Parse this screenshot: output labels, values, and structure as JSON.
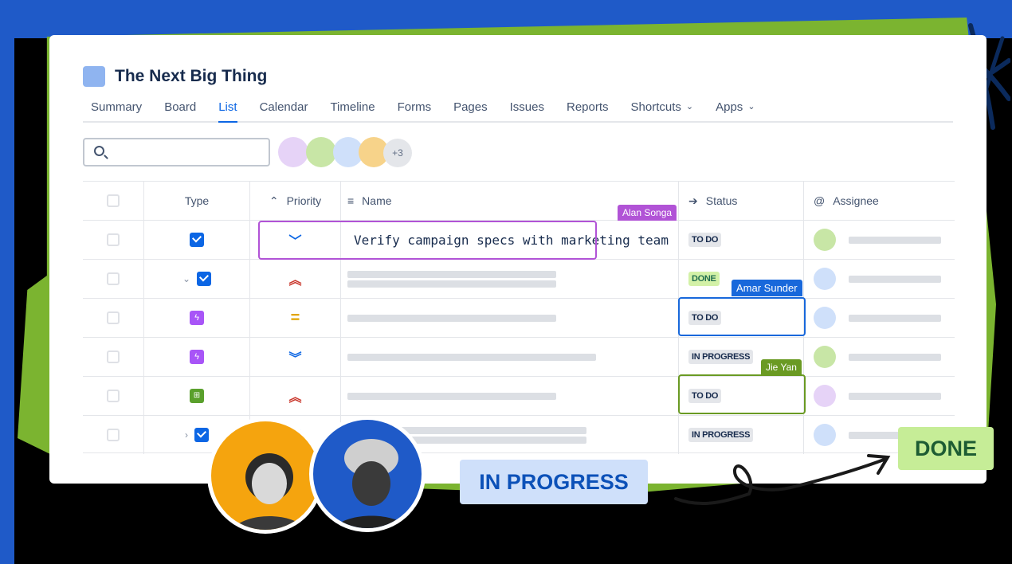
{
  "project": {
    "title": "The Next Big Thing",
    "icon_color": "#8fb4f0"
  },
  "tabs": [
    {
      "label": "Summary",
      "active": false
    },
    {
      "label": "Board",
      "active": false
    },
    {
      "label": "List",
      "active": true
    },
    {
      "label": "Calendar",
      "active": false
    },
    {
      "label": "Timeline",
      "active": false
    },
    {
      "label": "Forms",
      "active": false
    },
    {
      "label": "Pages",
      "active": false
    },
    {
      "label": "Issues",
      "active": false
    },
    {
      "label": "Reports",
      "active": false
    },
    {
      "label": "Shortcuts",
      "active": false,
      "dropdown": true
    },
    {
      "label": "Apps",
      "active": false,
      "dropdown": true
    }
  ],
  "search": {
    "placeholder": "",
    "icon": "search-icon"
  },
  "avatars": {
    "colors": [
      "#e6d3f7",
      "#c8e6a6",
      "#cfe0fa",
      "#f7d38a"
    ],
    "more_label": "+3"
  },
  "table": {
    "headers": {
      "type": "Type",
      "priority": "Priority",
      "name": "Name",
      "status": "Status",
      "assignee": "Assignee"
    },
    "rows": [
      {
        "type": "task-checkbox",
        "priority": "low",
        "name": "Verify campaign specs with marketing team",
        "status": "TO DO",
        "status_style": "default",
        "assignee_color": "#c8e6a6",
        "expander": ""
      },
      {
        "type": "task-checkbox",
        "priority": "high",
        "name": "",
        "status": "DONE",
        "status_style": "done",
        "assignee_color": "#cfe0fa",
        "expander": "⌄"
      },
      {
        "type": "subtask-purple",
        "priority": "medium",
        "name": "",
        "status": "TO DO",
        "status_style": "default",
        "assignee_color": "#cfe0fa",
        "expander": ""
      },
      {
        "type": "subtask-purple",
        "priority": "lowest",
        "name": "",
        "status": "IN PROGRESS",
        "status_style": "default",
        "assignee_color": "#c8e6a6",
        "expander": ""
      },
      {
        "type": "subtask-green",
        "priority": "high",
        "name": "",
        "status": "TO DO",
        "status_style": "default",
        "assignee_color": "#e6d3f7",
        "expander": ""
      },
      {
        "type": "task-checkbox",
        "priority": "low",
        "name": "",
        "status": "IN PROGRESS",
        "status_style": "default",
        "assignee_color": "#cfe0fa",
        "expander": "›"
      }
    ]
  },
  "collaborators": [
    {
      "name": "Alan Songa",
      "color": "#b153d6"
    },
    {
      "name": "Amar Sunder",
      "color": "#1868db"
    },
    {
      "name": "Jie Yan",
      "color": "#6a9a23"
    }
  ],
  "overlay": {
    "in_progress_label": "IN PROGRESS",
    "done_label": "DONE"
  },
  "colors": {
    "background": "#000000",
    "frame_blue": "#1f5ac8",
    "frame_green": "#7bb430",
    "accent": "#0c66e4"
  }
}
